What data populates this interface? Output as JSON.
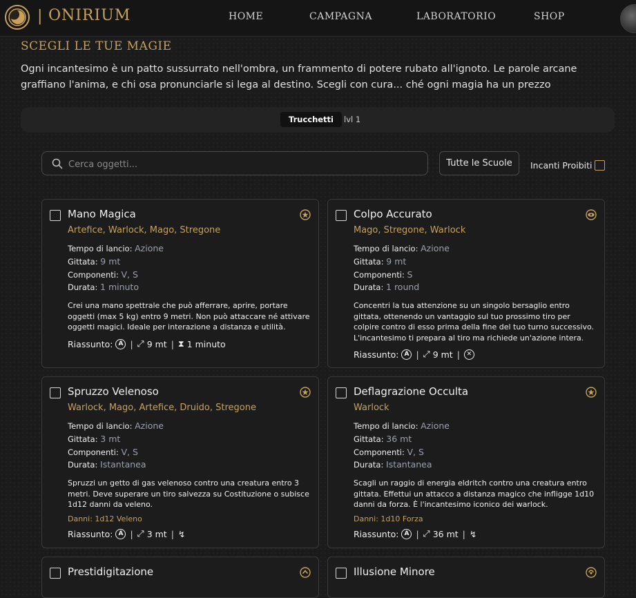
{
  "header": {
    "brand_sep": "|",
    "brand": "ONIRIUM",
    "nav": [
      "HOME",
      "CAMPAGNA",
      "LABORATORIO",
      "SHOP"
    ]
  },
  "main": {
    "title": "SCEGLI LE TUE MAGIE",
    "intro": "Ogni incantesimo è un patto sussurrato nell'ombra, un frammento di potere rubato all'ignoto. Le parole arcane graffiano l'anima, e chi osa pronunciarle si lega al destino. Scegli con cura... ché ogni magia ha un prezzo",
    "tabs": [
      {
        "label": "Trucchetti",
        "active": true
      },
      {
        "label": "lvl 1",
        "active": false
      }
    ],
    "filters": {
      "search_placeholder": "Cerca oggetti...",
      "schools_label": "Tutte le Scuole",
      "forbidden_label": "Incanti Proibiti"
    }
  },
  "labels": {
    "cast_time": "Tempo di lancio:",
    "range": "Gittata:",
    "components": "Componenti:",
    "duration": "Durata:",
    "summary": "Riassunto:"
  },
  "colors": {
    "accent": "#c8a25a",
    "background": "#1b1b1b",
    "value": "#9aa0ad"
  },
  "spells": [
    {
      "name": "Mano Magica",
      "school_icon": "evocation-star-icon",
      "classes": "Artefice, Warlock, Mago, Stregone",
      "cast_time": "Azione",
      "range": "9 mt",
      "components": "V, S",
      "duration": "1 minuto",
      "description": "Crei una mano spettrale che può afferrare, aprire, portare oggetti (max 5 kg) entro 9 metri. Non può attaccare né attivare oggetti magici. Ideale per interazione a distanza e utilità.",
      "damage": "",
      "summary": {
        "action": "A",
        "range": "9 mt",
        "duration": "1 minuto",
        "duration_icon": "hourglass-icon"
      }
    },
    {
      "name": "Colpo Accurato",
      "school_icon": "divination-eye-icon",
      "classes": "Mago, Stregone, Warlock",
      "cast_time": "Azione",
      "range": "9 mt",
      "components": "S",
      "duration": "1 round",
      "description": "Concentri la tua attenzione su un singolo bersaglio entro gittata, ottenendo un vantaggio sul tuo prossimo tiro per colpire contro di esso prima della fine del tuo turno successivo. L'incantesimo ti prepara al tiro ma richiede un'azione intera.",
      "damage": "",
      "summary": {
        "action": "A",
        "range": "9 mt",
        "duration": "",
        "duration_icon": "concentration-x-icon"
      }
    },
    {
      "name": "Spruzzo Velenoso",
      "school_icon": "evocation-star-icon",
      "classes": "Warlock, Mago, Artefice, Druido, Stregone",
      "cast_time": "Azione",
      "range": "3 mt",
      "components": "V, S",
      "duration": "Istantanea",
      "description": "Spruzzi un getto di gas velenoso contro una creatura entro 3 metri. Deve superare un tiro salvezza su Costituzione o subisce 1d12 danni da veleno.",
      "damage": "Danni: 1d12 Veleno",
      "summary": {
        "action": "A",
        "range": "3 mt",
        "duration": "",
        "duration_icon": "instant-icon"
      }
    },
    {
      "name": "Deflagrazione Occulta",
      "school_icon": "evocation-star-icon",
      "classes": "Warlock",
      "cast_time": "Azione",
      "range": "36 mt",
      "components": "V, S",
      "duration": "Istantanea",
      "description": "Scagli un raggio di energia eldritch contro una creatura entro gittata. Effettui un attacco a distanza magico che infligge 1d10 danni da forza. È l'incantesimo iconico dei warlock.",
      "damage": "Danni: 1d10 Forza",
      "summary": {
        "action": "A",
        "range": "36 mt",
        "duration": "",
        "duration_icon": "instant-icon"
      }
    },
    {
      "name": "Prestidigitazione",
      "school_icon": "transmutation-icon",
      "classes": "",
      "cast_time": "",
      "range": "",
      "components": "",
      "duration": "",
      "description": "",
      "damage": "",
      "summary": {
        "action": "",
        "range": "",
        "duration": "",
        "duration_icon": ""
      }
    },
    {
      "name": "Illusione Minore",
      "school_icon": "illusion-icon",
      "classes": "",
      "cast_time": "",
      "range": "",
      "components": "",
      "duration": "",
      "description": "",
      "damage": "",
      "summary": {
        "action": "",
        "range": "",
        "duration": "",
        "duration_icon": ""
      }
    }
  ]
}
